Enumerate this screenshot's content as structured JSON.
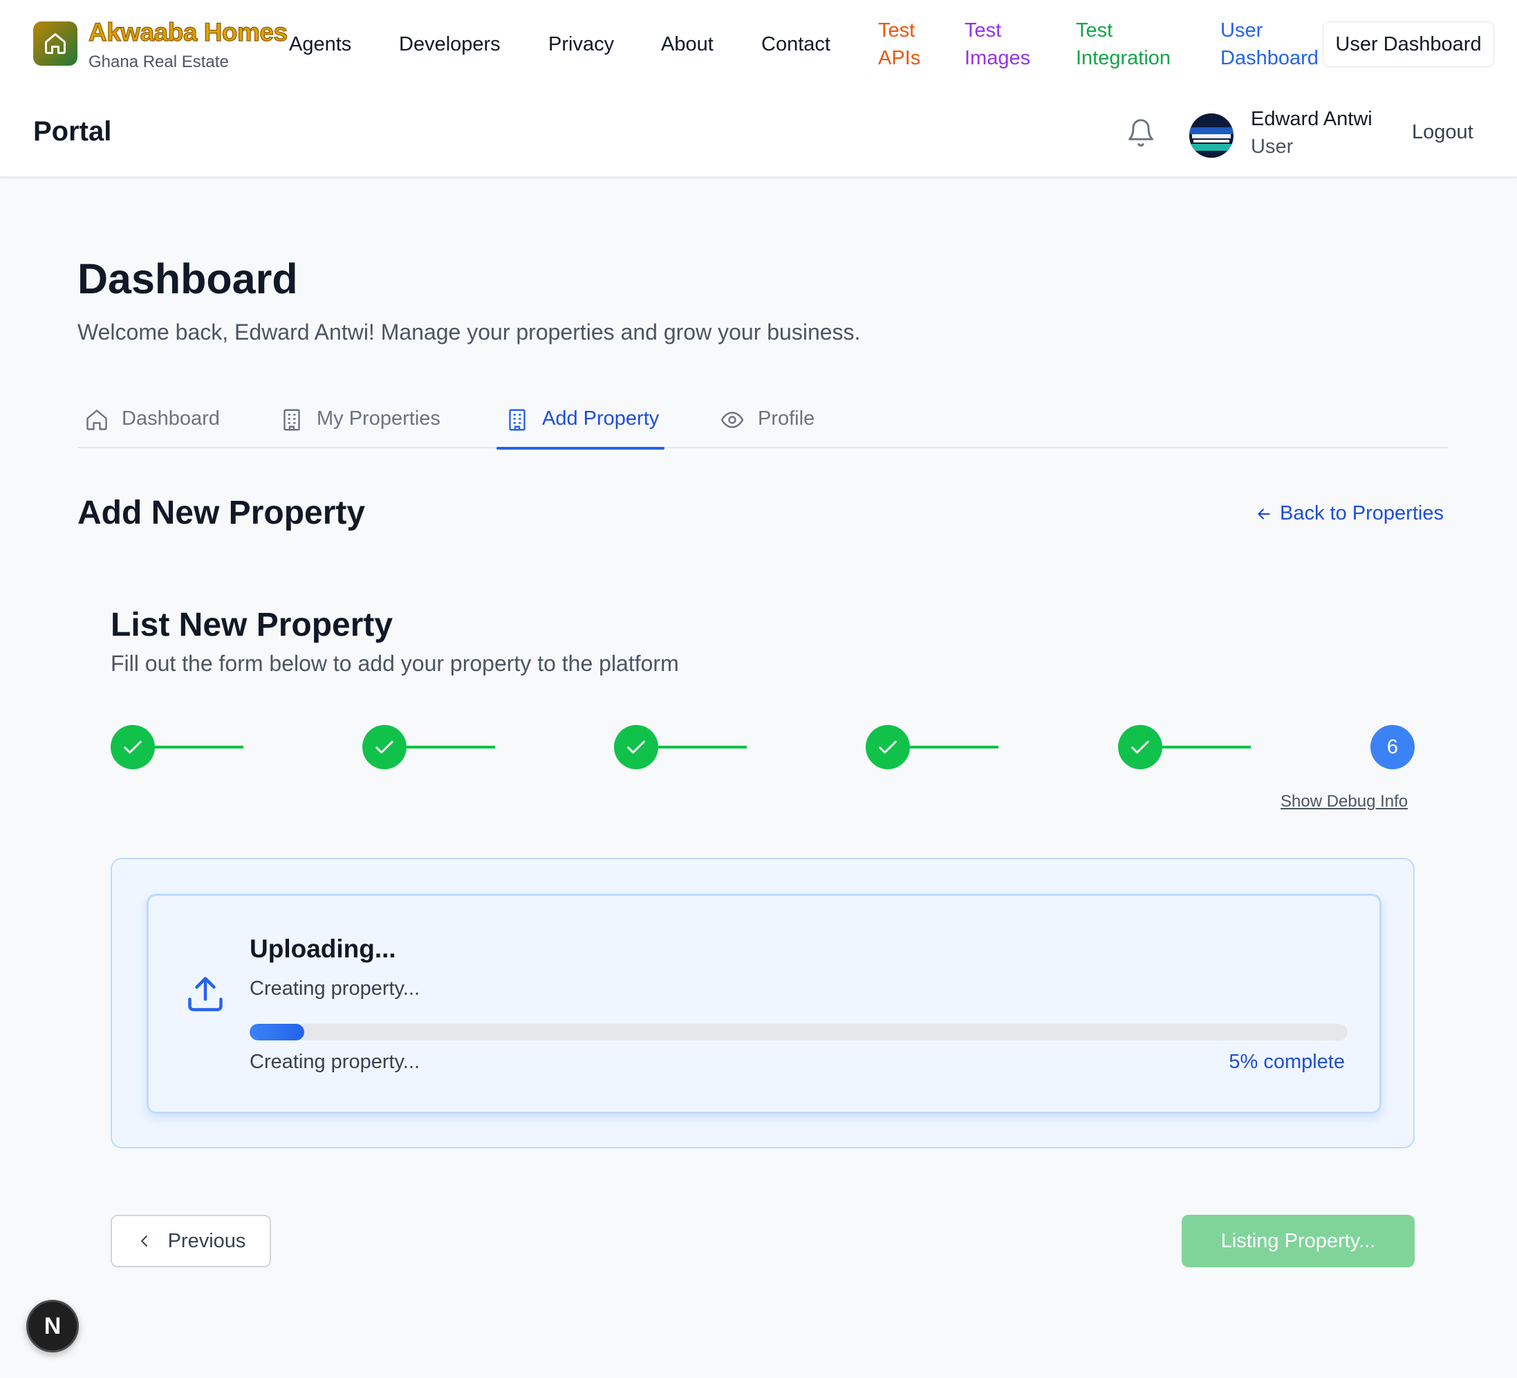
{
  "brand": {
    "name": "Akwaaba Homes",
    "tagline": "Ghana Real Estate"
  },
  "nav": {
    "links": [
      {
        "label": "Agents"
      },
      {
        "label": "Developers"
      },
      {
        "label": "Privacy"
      },
      {
        "label": "About"
      },
      {
        "label": "Contact"
      }
    ],
    "test_apis": {
      "line1": "Test",
      "line2": "APIs",
      "color": "#ea580c"
    },
    "test_images": {
      "line1": "Test",
      "line2": "Images",
      "color": "#9333ea"
    },
    "test_integration": {
      "line1": "Test",
      "line2": "Integration",
      "color": "#16a34a"
    },
    "user_dashboard_link": {
      "line1": "User",
      "line2": "Dashboard",
      "color": "#2563eb"
    },
    "user_dashboard_button": "User Dashboard"
  },
  "portal": {
    "title": "Portal",
    "user": {
      "name": "Edward Antwi",
      "role": "User"
    },
    "logout": "Logout"
  },
  "page": {
    "title": "Dashboard",
    "subtitle": "Welcome back, Edward Antwi! Manage your properties and grow your business."
  },
  "tabs": [
    {
      "label": "Dashboard",
      "icon": "home-icon",
      "active": false
    },
    {
      "label": "My Properties",
      "icon": "building-icon",
      "active": false
    },
    {
      "label": "Add Property",
      "icon": "building-icon",
      "active": true
    },
    {
      "label": "Profile",
      "icon": "eye-icon",
      "active": false
    }
  ],
  "section": {
    "title": "Add New Property",
    "back_link": "Back to Properties"
  },
  "form": {
    "title": "List New Property",
    "subtitle": "Fill out the form below to add your property to the platform",
    "steps": [
      {
        "state": "complete"
      },
      {
        "state": "complete"
      },
      {
        "state": "complete"
      },
      {
        "state": "complete"
      },
      {
        "state": "complete"
      },
      {
        "state": "current",
        "label": "6"
      }
    ],
    "debug_link": "Show Debug Info"
  },
  "upload": {
    "title": "Uploading...",
    "message": "Creating property...",
    "status": "Creating property...",
    "progress_percent": 5,
    "progress_label": "5% complete"
  },
  "buttons": {
    "previous": "Previous",
    "submit": "Listing Property..."
  },
  "badge": {
    "label": "N"
  },
  "colors": {
    "accent": "#2563eb",
    "success": "#10c24a",
    "submit_disabled": "#80d49a"
  }
}
